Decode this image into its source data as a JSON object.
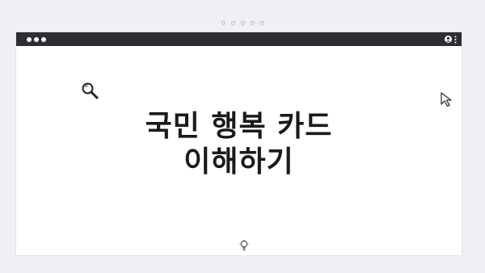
{
  "headline": {
    "line1": "국민 행복 카드",
    "line2": "이해하기"
  },
  "icons": {
    "search": "search-icon",
    "cursor": "cursor-arrow-icon",
    "lightbulb": "lightbulb-icon",
    "profile": "profile-icon",
    "menu": "kebab-menu-icon"
  },
  "colors": {
    "titlebar": "#2d2e33",
    "background": "#eef0f4",
    "text": "#1a1a1a"
  }
}
